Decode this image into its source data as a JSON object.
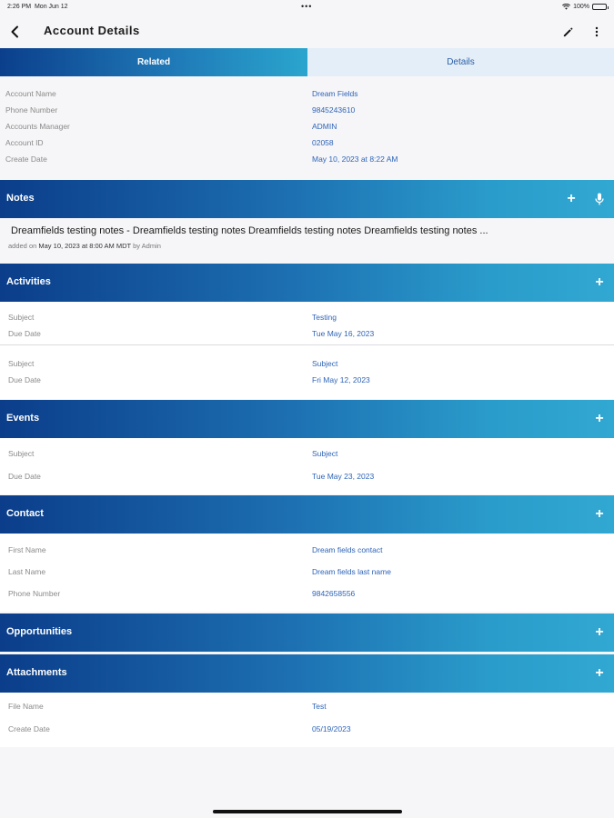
{
  "status_bar": {
    "time": "2:26 PM",
    "date": "Mon Jun 12",
    "dots": "•••",
    "battery": "100%"
  },
  "nav": {
    "title": "Account Details"
  },
  "tabs": [
    {
      "label": "Related"
    },
    {
      "label": "Details"
    }
  ],
  "account": [
    {
      "label": "Account Name",
      "value": "Dream Fields"
    },
    {
      "label": "Phone Number",
      "value": "9845243610"
    },
    {
      "label": "Accounts Manager",
      "value": "ADMIN"
    },
    {
      "label": "Account ID",
      "value": "02058"
    },
    {
      "label": "Create Date",
      "value": "May 10, 2023 at 8:22 AM"
    }
  ],
  "notes": {
    "title": "Notes",
    "text": "Dreamfields testing notes - Dreamfields testing notes Dreamfields testing notes Dreamfields testing notes ...",
    "meta_prefix": "added on",
    "meta_date": "May 10, 2023 at 8:00 AM MDT",
    "meta_by": "by",
    "meta_author": "Admin"
  },
  "activities": {
    "title": "Activities",
    "items": [
      [
        {
          "label": "Subject",
          "value": "Testing"
        },
        {
          "label": "Due Date",
          "value": "Tue May 16, 2023"
        }
      ],
      [
        {
          "label": "Subject",
          "value": "Subject"
        },
        {
          "label": "Due Date",
          "value": "Fri May 12, 2023"
        }
      ]
    ]
  },
  "events": {
    "title": "Events",
    "items": [
      {
        "label": "Subject",
        "value": "Subject"
      },
      {
        "label": "Due Date",
        "value": "Tue May 23, 2023"
      }
    ]
  },
  "contact": {
    "title": "Contact",
    "items": [
      {
        "label": "First Name",
        "value": "Dream fields contact"
      },
      {
        "label": "Last Name",
        "value": "Dream fields last name"
      },
      {
        "label": "Phone Number",
        "value": "9842658556"
      }
    ]
  },
  "opportunities": {
    "title": "Opportunities"
  },
  "attachments": {
    "title": "Attachments",
    "items": [
      {
        "label": "File Name",
        "value": "Test"
      },
      {
        "label": "Create Date",
        "value": "05/19/2023"
      }
    ]
  },
  "colors": {
    "accent": "#1c6db0",
    "link": "#2e64b8",
    "label": "#8a8a8a"
  },
  "icons": {
    "back": "chevron-left-icon",
    "edit": "pencil-icon",
    "more": "more-vertical-icon",
    "add": "plus-icon",
    "mic": "microphone-icon"
  }
}
